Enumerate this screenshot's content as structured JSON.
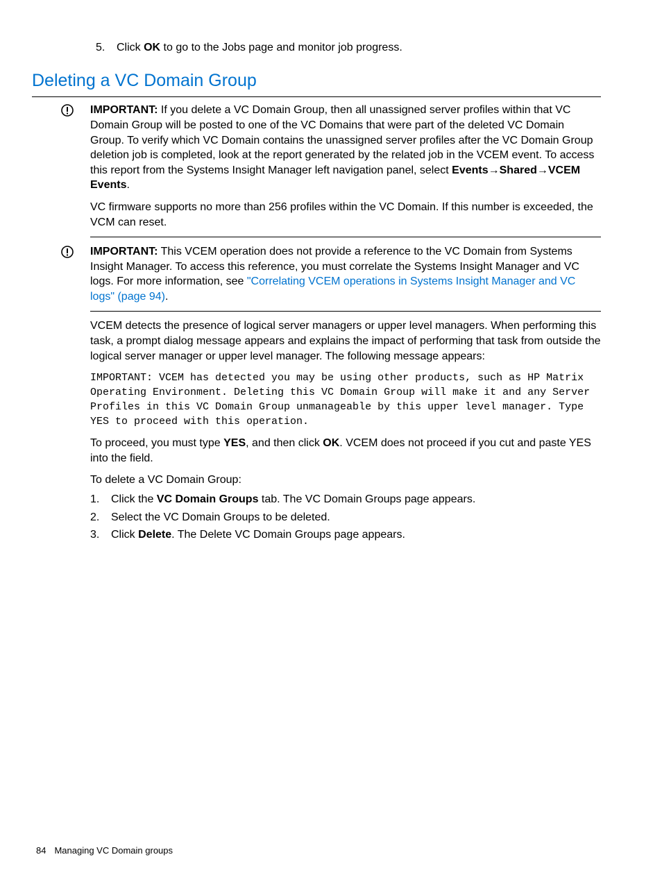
{
  "step5": {
    "num": "5.",
    "pre": "Click ",
    "bold": "OK",
    "post": " to go to the Jobs page and monitor job progress."
  },
  "heading": "Deleting a VC Domain Group",
  "admon1": {
    "label": "IMPORTANT:",
    "p1_pre": "   If you delete a VC Domain Group, then all unassigned server profiles within that VC Domain Group will be posted to one of the VC Domains that were part of the deleted VC Domain Group. To verify which VC Domain contains the unassigned server profiles after the VC Domain Group deletion job is completed, look at the report generated by the related job in the VCEM event. To access this report from the Systems Insight Manager left navigation panel, select ",
    "p1_bold": "Events→Shared→VCEM Events",
    "p1_post": ".",
    "p2": "VC firmware supports no more than 256 profiles within the VC Domain. If this number is exceeded, the VCM can reset."
  },
  "admon2": {
    "label": "IMPORTANT:",
    "p1": "   This VCEM operation does not provide a reference to the VC Domain from Systems Insight Manager. To access this reference, you must correlate the Systems Insight Manager and VC logs. For more information, see ",
    "link": "\"Correlating VCEM operations in Systems Insight Manager and VC logs\" (page 94)",
    "post": "."
  },
  "detect_para": "VCEM detects the presence of logical server managers or upper level managers. When performing this task, a prompt dialog message appears and explains the impact of performing that task from outside the logical server manager or upper level manager. The following message appears:",
  "mono_msg": "IMPORTANT: VCEM has detected you may be using other products, such as HP Matrix Operating Environment. Deleting this VC Domain Group will make it and any Server Profiles in this VC Domain Group unmanageable by this upper level manager. Type YES to proceed with this operation.",
  "proceed": {
    "pre": "To proceed, you must type ",
    "b1": "YES",
    "mid": ", and then click ",
    "b2": "OK",
    "post": ". VCEM does not proceed if you cut and paste YES into the field."
  },
  "intro_steps": "To delete a VC Domain Group:",
  "steps": [
    {
      "n": "1.",
      "pre": "Click the ",
      "b": "VC Domain Groups",
      "post": " tab. The VC Domain Groups page appears."
    },
    {
      "n": "2.",
      "pre": "Select the VC Domain Groups to be deleted.",
      "b": "",
      "post": ""
    },
    {
      "n": "3.",
      "pre": "Click ",
      "b": "Delete",
      "post": ". The Delete VC Domain Groups page appears."
    }
  ],
  "footer": {
    "page": "84",
    "title": "Managing VC Domain groups"
  }
}
